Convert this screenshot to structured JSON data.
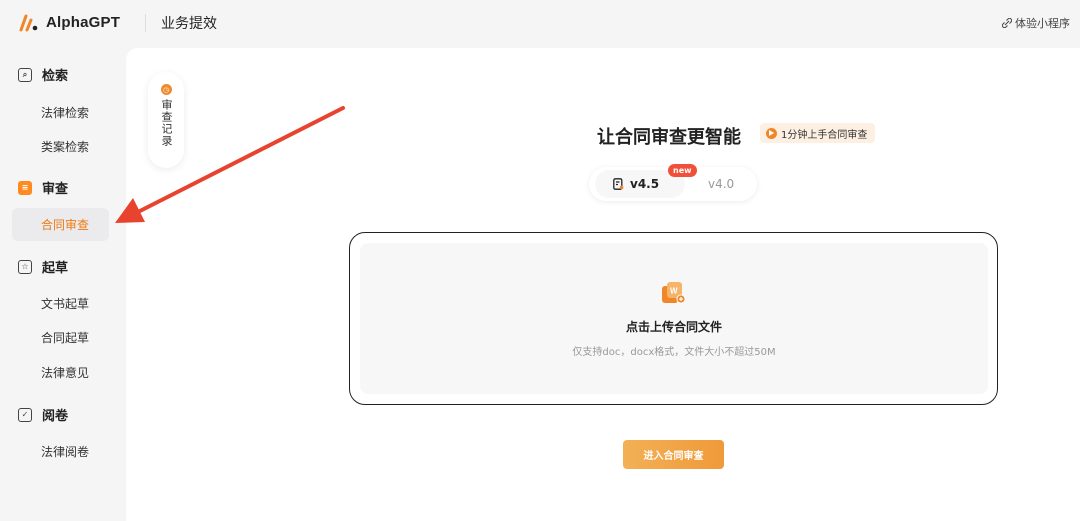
{
  "header": {
    "app_name": "AlphaGPT",
    "section_title": "业务提效",
    "mini_program": "体验小程序"
  },
  "sidebar": {
    "groups": [
      {
        "title": "检索",
        "icon": "search-icon",
        "items": [
          "法律检索",
          "类案检索"
        ]
      },
      {
        "title": "审查",
        "icon": "document-icon",
        "items": [
          "合同审查"
        ]
      },
      {
        "title": "起草",
        "icon": "star-icon",
        "items": [
          "文书起草",
          "合同起草",
          "法律意见"
        ]
      },
      {
        "title": "阅卷",
        "icon": "check-icon",
        "items": [
          "法律阅卷"
        ]
      }
    ],
    "active_item": "合同审查"
  },
  "history": {
    "label": "审查记录"
  },
  "main": {
    "title": "让合同审查更智能",
    "tutorial_tag": "1分钟上手合同审查",
    "versions": {
      "active": "v4.5",
      "badge": "new",
      "other": "v4.0"
    },
    "upload": {
      "title": "点击上传合同文件",
      "hint": "仅支持doc，docx格式，文件大小不超过50M"
    },
    "start_button": "进入合同审查"
  },
  "colors": {
    "accent": "#ee7a13",
    "annotation_arrow": "#e8432e"
  }
}
